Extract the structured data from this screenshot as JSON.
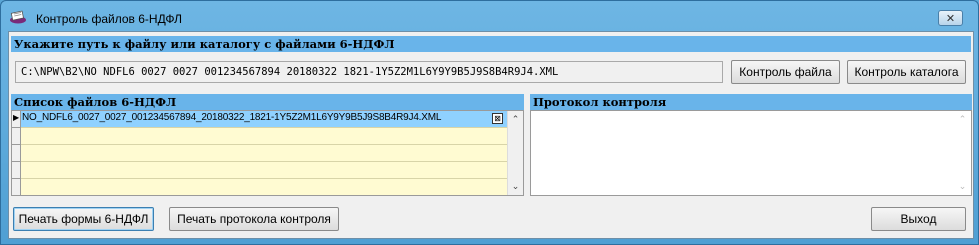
{
  "window": {
    "title": "Контроль файлов 6-НДФЛ",
    "close_glyph": "✕"
  },
  "path_section": {
    "header": "Укажите путь к файлу или каталогу с файлами 6-НДФЛ",
    "path_value": "C:\\NPW\\B2\\NO NDFL6 0027 0027 001234567894 20180322 1821-1Y5Z2M1L6Y9Y9B5J9S8B4R9J4.XML",
    "check_file_label": "Контроль файла",
    "check_folder_label": "Контроль каталога"
  },
  "files_section": {
    "header": "Список файлов 6-НДФЛ",
    "rows": [
      {
        "file": "NO_NDFL6_0027_0027_001234567894_20180322_1821-1Y5Z2M1L6Y9Y9B5J9S8B4R9J4.XML",
        "button_glyph": "⊠"
      }
    ],
    "current_row_marker": "▶",
    "scroll_up": "⌃",
    "scroll_down": "⌄"
  },
  "protocol_section": {
    "header": "Протокол контроля"
  },
  "footer": {
    "print_form_label": "Печать формы 6-НДФЛ",
    "print_protocol_label": "Печать протокола контроля",
    "exit_label": "Выход"
  }
}
